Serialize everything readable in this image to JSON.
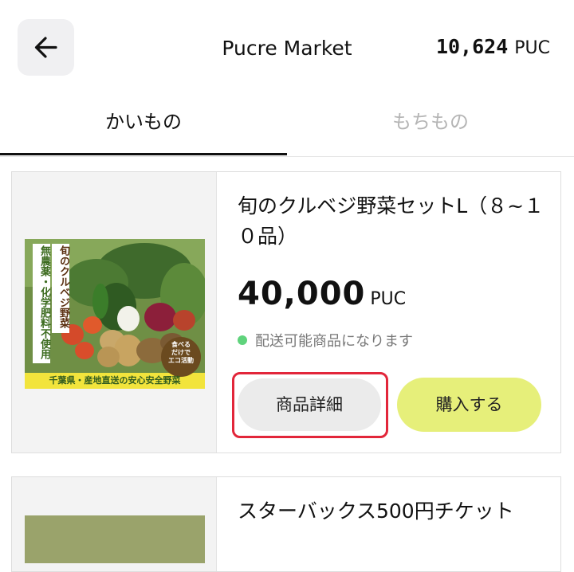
{
  "header": {
    "title": "Pucre Market",
    "balance_amount": "10,624",
    "balance_unit": "PUC",
    "back_icon": "arrow-left-icon"
  },
  "tabs": [
    {
      "label": "かいもの",
      "active": true
    },
    {
      "label": "もちもの",
      "active": false
    }
  ],
  "products": [
    {
      "name": "旬のクルベジ野菜セットL（８~１０品）",
      "price": "40,000",
      "unit": "PUC",
      "availability": "配送可能商品になります",
      "detail_label": "商品詳細",
      "buy_label": "購入する",
      "image_text": {
        "vertical_1": "無農薬・化学肥料不使用",
        "vertical_2": "旬のクルベジ野菜",
        "bottom": "千葉県・産地直送の安心安全野菜",
        "badge_1": "食べる",
        "badge_2": "だけで",
        "badge_3": "エコ活動"
      }
    },
    {
      "name": "スターバックス500円チケット"
    }
  ],
  "colors": {
    "accent_buy": "#e6ef7a",
    "detail_button": "#ebebeb",
    "highlight": "#e2263a",
    "available_dot": "#5fd37c",
    "inactive_tab": "#b5b5b5"
  }
}
